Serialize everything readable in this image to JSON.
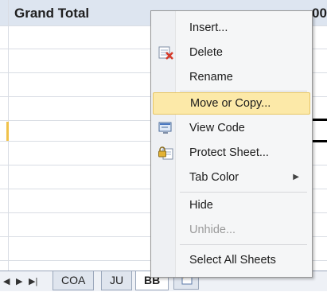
{
  "sheet": {
    "grand_total_label": "Grand Total",
    "partial_value": "00"
  },
  "tabs": {
    "nav": [
      "◀",
      "▶",
      "▶|"
    ],
    "items": [
      {
        "label": "COA",
        "active": false
      },
      {
        "label": "JU",
        "active": false
      },
      {
        "label": "BB",
        "active": true
      }
    ]
  },
  "menu": {
    "items": [
      {
        "label": "Insert...",
        "icon": null
      },
      {
        "label": "Delete",
        "icon": "delete-sheet-icon"
      },
      {
        "label": "Rename",
        "icon": null
      },
      {
        "label": "Move or Copy...",
        "icon": null,
        "highlighted": true
      },
      {
        "label": "View Code",
        "icon": "view-code-icon"
      },
      {
        "label": "Protect Sheet...",
        "icon": "protect-sheet-icon"
      },
      {
        "label": "Tab Color",
        "icon": null,
        "submenu": true
      },
      {
        "label": "Hide",
        "icon": null
      },
      {
        "label": "Unhide...",
        "icon": null,
        "disabled": true
      },
      {
        "label": "Select All Sheets",
        "icon": null
      }
    ]
  },
  "colors": {
    "highlight": "#fce9a8",
    "header_bg": "#dde5f0"
  }
}
